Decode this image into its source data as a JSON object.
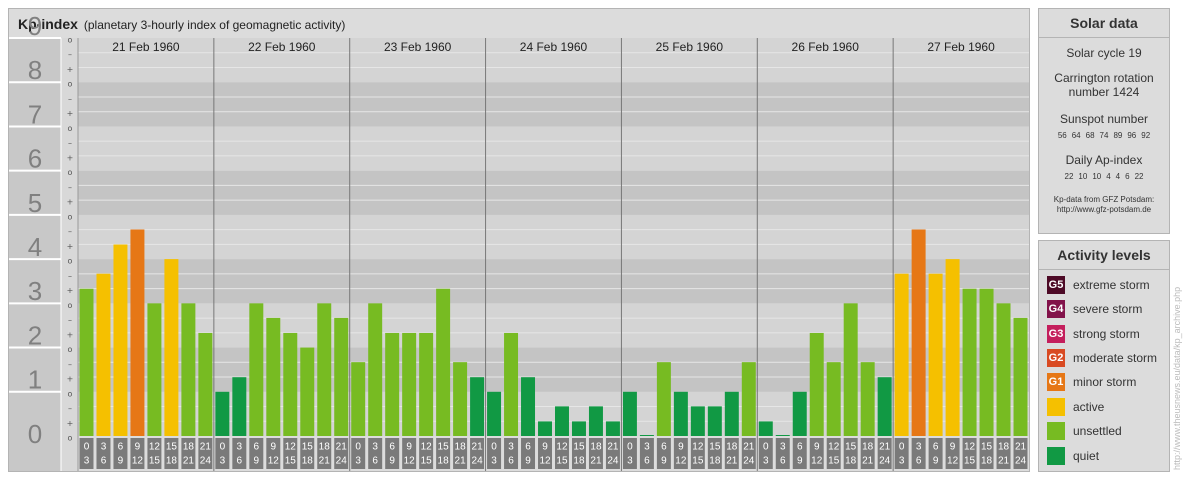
{
  "title": "Kp-index",
  "subtitle": "(planetary 3-hourly index of geomagnetic activity)",
  "colors": {
    "quiet": "#119944",
    "unsettled": "#77bb22",
    "active": "#f5c000",
    "minor_storm": "#e67716",
    "moderate_storm": "#d94a22",
    "strong_storm": "#c41e5c",
    "severe_storm": "#82124a",
    "extreme_storm": "#4d0a26"
  },
  "chart_data": {
    "type": "bar",
    "ylim": [
      0,
      9
    ],
    "y_ticks": [
      "0",
      "1",
      "2",
      "3",
      "4",
      "5",
      "6",
      "7",
      "8",
      "9"
    ],
    "minor_tick_labels": [
      "o",
      "+",
      "–"
    ],
    "days": [
      "21 Feb 1960",
      "22 Feb 1960",
      "23 Feb 1960",
      "24 Feb 1960",
      "25 Feb 1960",
      "26 Feb 1960",
      "27 Feb 1960"
    ],
    "interval_labels": [
      {
        "top": "0",
        "bottom": "3"
      },
      {
        "top": "3",
        "bottom": "6"
      },
      {
        "top": "6",
        "bottom": "9"
      },
      {
        "top": "9",
        "bottom": "12"
      },
      {
        "top": "12",
        "bottom": "15"
      },
      {
        "top": "15",
        "bottom": "18"
      },
      {
        "top": "18",
        "bottom": "21"
      },
      {
        "top": "21",
        "bottom": "24"
      }
    ],
    "kp_values": [
      [
        3.33,
        3.67,
        4.33,
        4.67,
        3.0,
        4.0,
        3.0,
        2.33
      ],
      [
        1.0,
        1.33,
        3.0,
        2.67,
        2.33,
        2.0,
        3.0,
        2.67
      ],
      [
        1.67,
        3.0,
        2.33,
        2.33,
        2.33,
        3.33,
        1.67,
        1.33
      ],
      [
        1.0,
        2.33,
        1.33,
        0.33,
        0.67,
        0.33,
        0.67,
        0.33
      ],
      [
        1.0,
        0.0,
        1.67,
        1.0,
        0.67,
        0.67,
        1.0,
        1.67
      ],
      [
        0.33,
        0.0,
        1.0,
        2.33,
        1.67,
        3.0,
        1.67,
        1.33
      ],
      [
        3.67,
        4.67,
        3.67,
        4.0,
        3.33,
        3.33,
        3.0,
        2.67
      ]
    ]
  },
  "solar": {
    "heading": "Solar data",
    "cycle": "Solar cycle 19",
    "carrington_line1": "Carrington rotation",
    "carrington_line2": "number 1424",
    "sunspot_label": "Sunspot number",
    "sunspot_values": [
      "56",
      "64",
      "68",
      "74",
      "89",
      "96",
      "92"
    ],
    "ap_label": "Daily Ap-index",
    "ap_values": [
      "22",
      "10",
      "10",
      "4",
      "4",
      "6",
      "22"
    ],
    "source_line1": "Kp-data from GFZ Potsdam:",
    "source_line2": "http://www.gfz-potsdam.de"
  },
  "activity": {
    "heading": "Activity levels",
    "levels": [
      {
        "code": "G5",
        "label": "extreme storm",
        "color": "#4d0a26"
      },
      {
        "code": "G4",
        "label": "severe storm",
        "color": "#82124a"
      },
      {
        "code": "G3",
        "label": "strong storm",
        "color": "#c41e5c"
      },
      {
        "code": "G2",
        "label": "moderate storm",
        "color": "#d94a22"
      },
      {
        "code": "G1",
        "label": "minor storm",
        "color": "#e67716"
      },
      {
        "code": "",
        "label": "active",
        "color": "#f5c000"
      },
      {
        "code": "",
        "label": "unsettled",
        "color": "#77bb22"
      },
      {
        "code": "",
        "label": "quiet",
        "color": "#119944"
      }
    ]
  },
  "watermark": "http://www.theusnews.eu/data/kp_archive.php"
}
